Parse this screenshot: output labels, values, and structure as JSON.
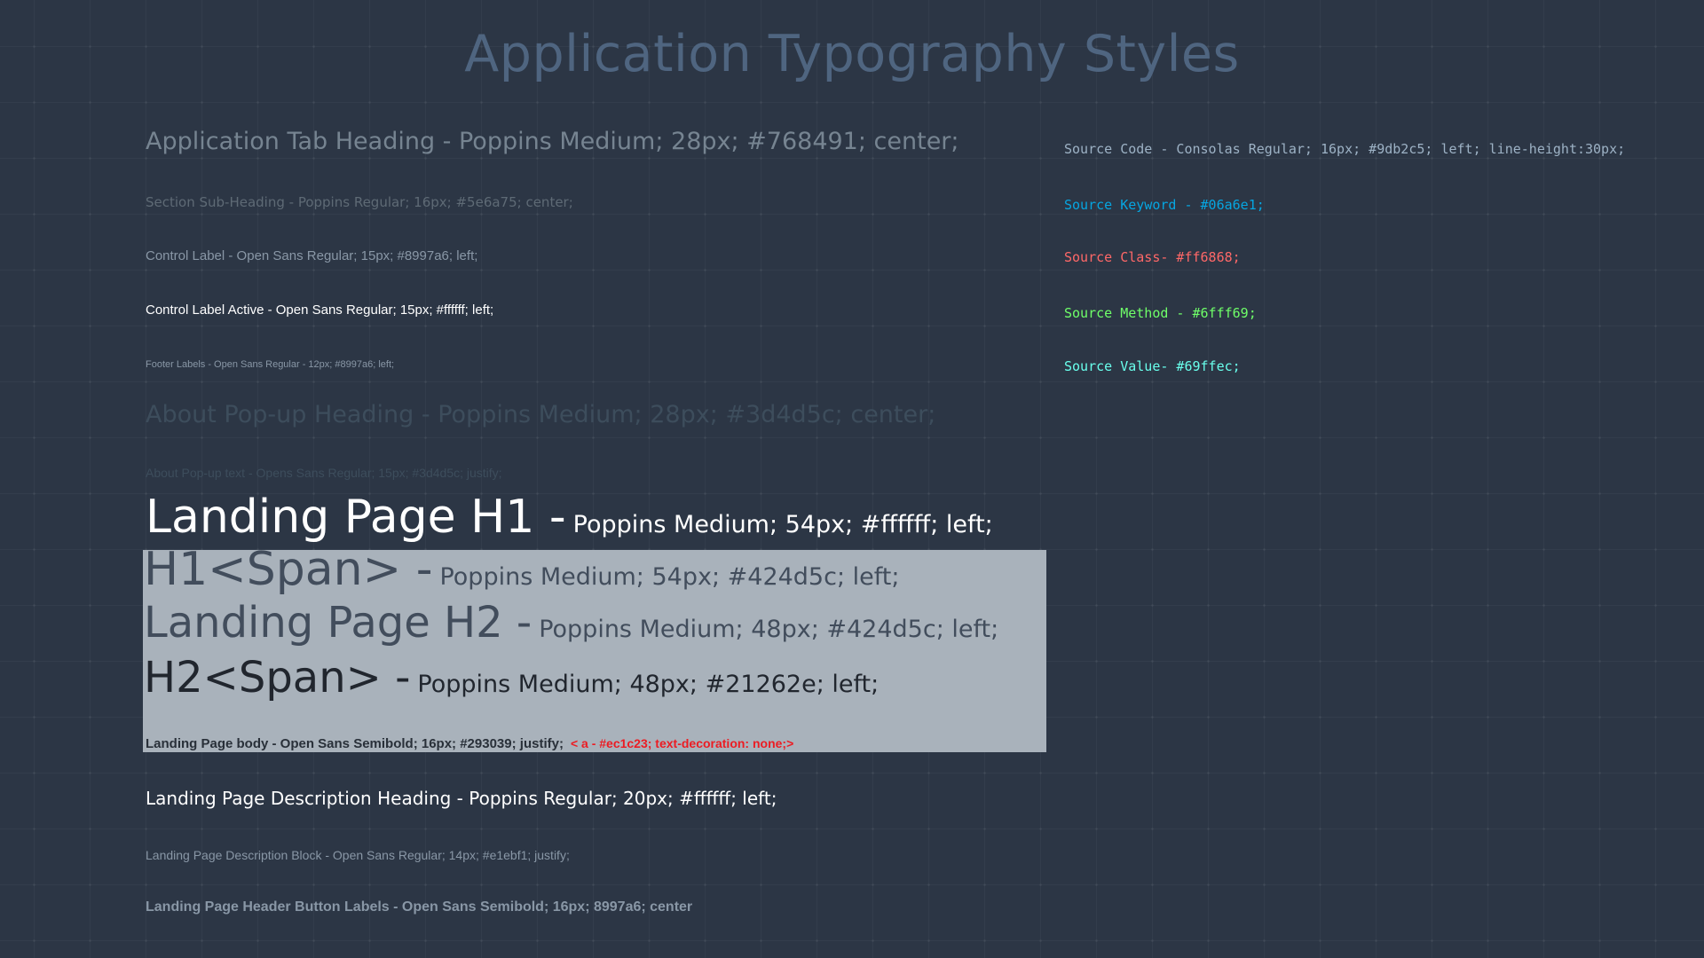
{
  "title": "Application Typography Styles",
  "styles": {
    "tab_heading": "Application Tab Heading - Poppins Medium; 28px; #768491; center;",
    "sub_heading": "Section Sub-Heading - Poppins Regular; 16px; #5e6a75; center;",
    "control_label": "Control Label - Open Sans Regular; 15px; #8997a6; left;",
    "control_label_active": "Control Label Active - Open Sans Regular; 15px; #ffffff; left;",
    "footer_label": "Footer Labels - Open Sans Regular - 12px; #8997a6; left;",
    "about_heading": "About Pop-up Heading - Poppins Medium; 28px; #3d4d5c; center;",
    "about_text": "About Pop-up text - Opens Sans Regular; 15px; #3d4d5c; justify;",
    "h1_big": "Landing Page H1 -",
    "h1_small": "Poppins Medium; 54px; #ffffff; left;",
    "h1span_big": "H1<Span> -",
    "h1span_small": "Poppins Medium; 54px; #424d5c; left;",
    "h2_big": "Landing Page H2 -",
    "h2_small": "Poppins Medium; 48px; #424d5c; left;",
    "h2span_big": "H2<Span> -",
    "h2span_small": "Poppins Medium; 48px; #21262e; left;",
    "body": "Landing Page body - Open Sans Semibold; 16px; #293039; justify;",
    "body_link": "< a - #ec1c23; text-decoration: none;>",
    "desc_heading": "Landing Page Description Heading - Poppins Regular; 20px; #ffffff; left;",
    "desc_block": "Landing Page Description Block - Open Sans Regular; 14px; #e1ebf1; justify;",
    "header_button_labels": "Landing Page Header Button Labels - Open Sans Semibold; 16px; 8997a6; center"
  },
  "code": {
    "source": "Source Code - Consolas Regular; 16px; #9db2c5; left; line-height:30px;",
    "keyword": "Source Keyword - #06a6e1;",
    "class": "Source Class- #ff6868;",
    "method": "Source Method - #6fff69;",
    "value": "Source Value- #69ffec;"
  },
  "colors": {
    "background": "#2c3645",
    "panel": "#a9b2bb",
    "link": "#ec1c23"
  }
}
